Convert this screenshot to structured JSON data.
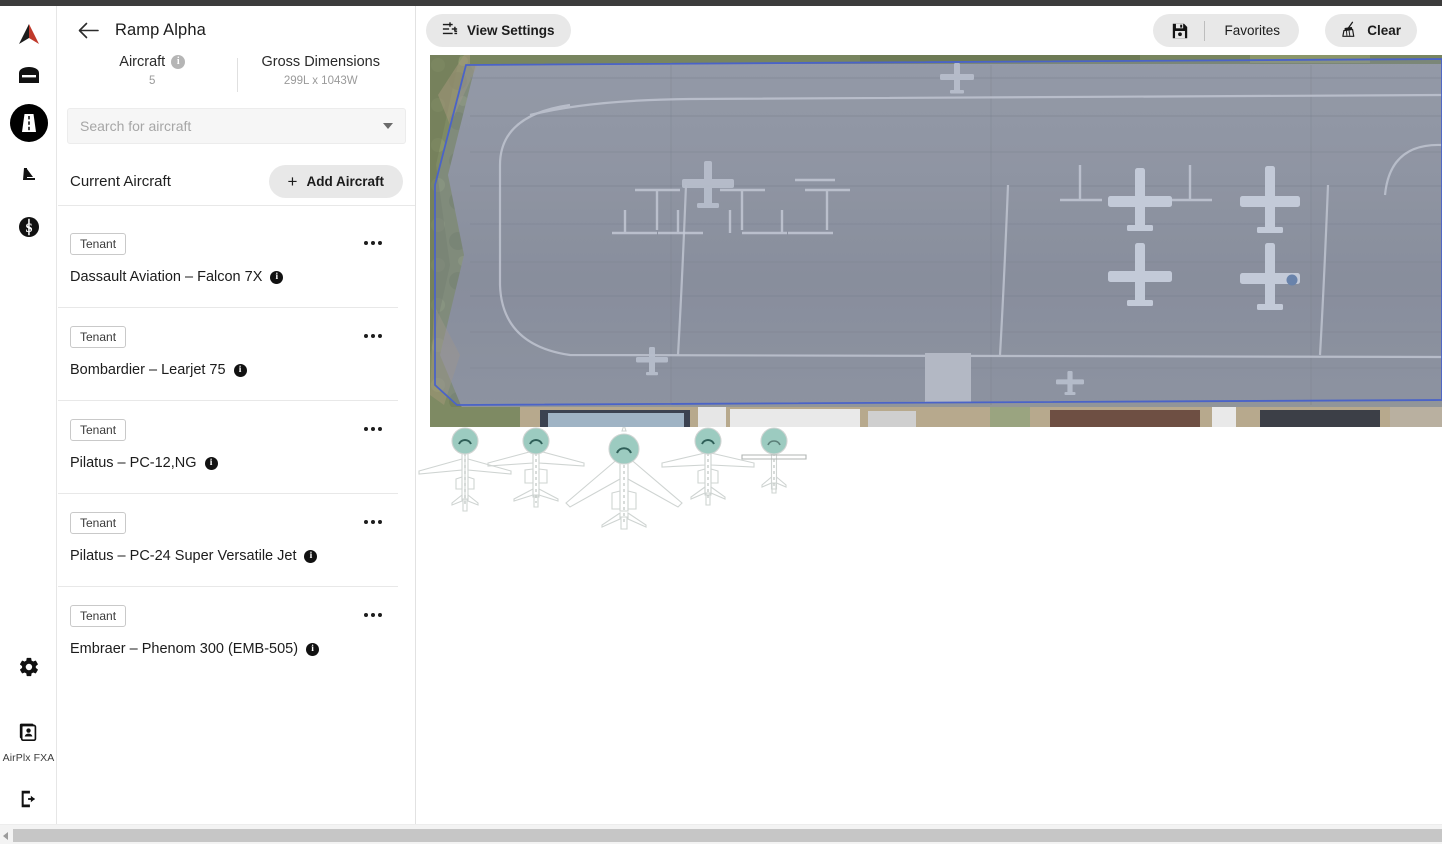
{
  "app": {
    "rail": {
      "items": [
        {
          "name": "logo-icon",
          "label": "AirPlx Logo",
          "active": false
        },
        {
          "name": "hangar-icon",
          "label": "Hangars",
          "active": false
        },
        {
          "name": "ramp-icon",
          "label": "Ramps",
          "active": true
        },
        {
          "name": "aircraft-tail-icon",
          "label": "Aircraft",
          "active": false
        },
        {
          "name": "billing-icon",
          "label": "Billing",
          "active": false
        }
      ],
      "bottom": [
        {
          "name": "settings-gear-icon",
          "label": "Settings"
        },
        {
          "name": "account-card-icon",
          "label": "AirPlx FXA"
        },
        {
          "name": "logout-icon",
          "label": "Log out"
        }
      ],
      "account_label": "AirPlx FXA"
    },
    "panel": {
      "back_label": "Back",
      "title": "Ramp Alpha",
      "stats": [
        {
          "label": "Aircraft",
          "value": "5",
          "has_info": true
        },
        {
          "label": "Gross Dimensions",
          "value": "299L x 1043W",
          "has_info": false
        }
      ],
      "search": {
        "placeholder": "Search for aircraft",
        "value": ""
      },
      "section_title": "Current Aircraft",
      "add_button": "Add Aircraft",
      "add_button_icon": "plus-icon",
      "aircraft": [
        {
          "badge": "Tenant",
          "name": "Dassault Aviation – Falcon 7X"
        },
        {
          "badge": "Tenant",
          "name": "Bombardier – Learjet 75"
        },
        {
          "badge": "Tenant",
          "name": "Pilatus – PC-12,NG"
        },
        {
          "badge": "Tenant",
          "name": "Pilatus – PC-24 Super Versatile Jet"
        },
        {
          "badge": "Tenant",
          "name": "Embraer – Phenom 300 (EMB-505)"
        }
      ],
      "menu_icon": "more-options-icon",
      "info_icon": "info-icon"
    },
    "toolbar": {
      "view_settings": "View Settings",
      "view_settings_icon": "sliders-icon",
      "save_icon": "floppy-disk-icon",
      "favorites": "Favorites",
      "clear": "Clear",
      "clear_icon": "broom-icon"
    },
    "map": {
      "name": "ramp-satellite-map",
      "boundary_color": "#4a63c8",
      "boundary_fill": "#7b85a8",
      "marker_color": "#9ccbc0"
    },
    "placed_aircraft": [
      {
        "label": "Dassault Aviation – Falcon 7X",
        "type": "midjet"
      },
      {
        "label": "Bombardier – Learjet 75",
        "type": "midjet"
      },
      {
        "label": "Pilatus – PC-24 Super Versatile Jet",
        "type": "largejet"
      },
      {
        "label": "Pilatus – PC-12,NG",
        "type": "midjet"
      },
      {
        "label": "Embraer – Phenom 300 (EMB-505)",
        "type": "turboprop"
      }
    ],
    "scrollbars": {
      "vertical_name": "aircraft-list-scrollbar",
      "horizontal_name": "page-horizontal-scrollbar"
    }
  }
}
